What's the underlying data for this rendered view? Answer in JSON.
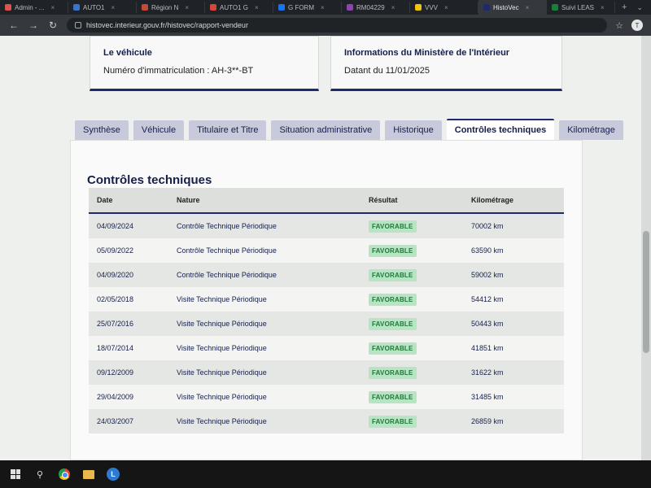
{
  "browser": {
    "tabs": [
      {
        "label": "Admin - ...",
        "color": "#d9534f"
      },
      {
        "label": "AUTO1",
        "color": "#3b73d1"
      },
      {
        "label": "Région N",
        "color": "#c74a39"
      },
      {
        "label": "AUTO1 G",
        "color": "#d44638"
      },
      {
        "label": "G FORM",
        "color": "#1a73e8"
      },
      {
        "label": "RM04229",
        "color": "#8e44ad"
      },
      {
        "label": "VVV",
        "color": "#f1c40f"
      },
      {
        "label": "HistoVec",
        "color": "#1d2b6c"
      },
      {
        "label": "Suivi LEAS",
        "color": "#188038"
      }
    ],
    "active_tab_index": 7,
    "url": "histovec.interieur.gouv.fr/histovec/rapport-vendeur"
  },
  "vehicle_card": {
    "title": "Le véhicule",
    "value": "Numéro d'immatriculation : AH-3**-BT"
  },
  "ministry_card": {
    "title": "Informations du Ministère de l'Intérieur",
    "value": "Datant du 11/01/2025"
  },
  "tabs": [
    {
      "label": "Synthèse"
    },
    {
      "label": "Véhicule"
    },
    {
      "label": "Titulaire et Titre"
    },
    {
      "label": "Situation administrative"
    },
    {
      "label": "Historique"
    },
    {
      "label": "Contrôles techniques"
    },
    {
      "label": "Kilométrage"
    }
  ],
  "active_tab": 5,
  "section_title": "Contrôles techniques",
  "table": {
    "headers": {
      "date": "Date",
      "nature": "Nature",
      "result": "Résultat",
      "km": "Kilométrage"
    },
    "rows": [
      {
        "date": "04/09/2024",
        "nature": "Contrôle Technique Périodique",
        "result": "FAVORABLE",
        "km": "70002 km"
      },
      {
        "date": "05/09/2022",
        "nature": "Contrôle Technique Périodique",
        "result": "FAVORABLE",
        "km": "63590 km"
      },
      {
        "date": "04/09/2020",
        "nature": "Contrôle Technique Périodique",
        "result": "FAVORABLE",
        "km": "59002 km"
      },
      {
        "date": "02/05/2018",
        "nature": "Visite Technique Périodique",
        "result": "FAVORABLE",
        "km": "54412 km"
      },
      {
        "date": "25/07/2016",
        "nature": "Visite Technique Périodique",
        "result": "FAVORABLE",
        "km": "50443 km"
      },
      {
        "date": "18/07/2014",
        "nature": "Visite Technique Périodique",
        "result": "FAVORABLE",
        "km": "41851 km"
      },
      {
        "date": "09/12/2009",
        "nature": "Visite Technique Périodique",
        "result": "FAVORABLE",
        "km": "31622 km"
      },
      {
        "date": "29/04/2009",
        "nature": "Visite Technique Périodique",
        "result": "FAVORABLE",
        "km": "31485 km"
      },
      {
        "date": "24/03/2007",
        "nature": "Visite Technique Périodique",
        "result": "FAVORABLE",
        "km": "26859 km"
      }
    ]
  },
  "colors": {
    "navy": "#1d2b6c",
    "favorable_bg": "#b7e4c2",
    "favorable_text": "#1f7a3a"
  },
  "taskbar": {
    "app_letter": "L"
  }
}
